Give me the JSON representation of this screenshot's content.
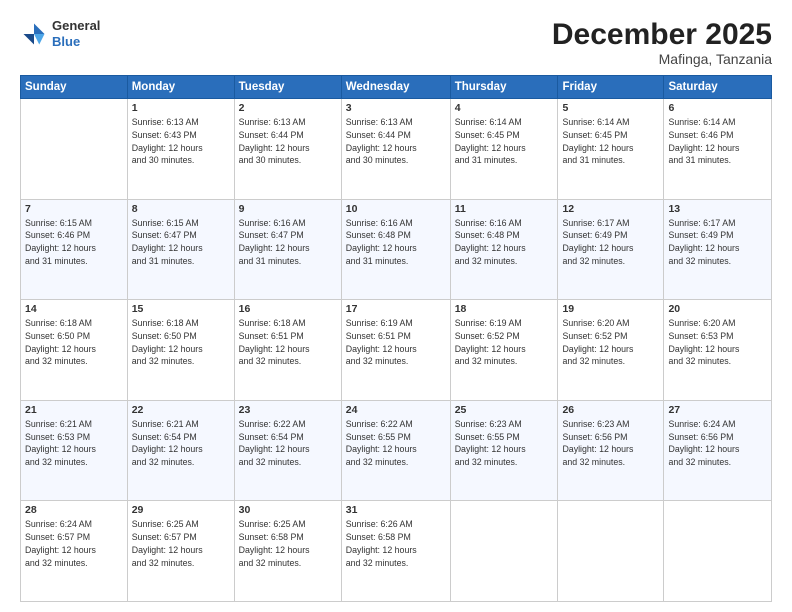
{
  "header": {
    "logo_line1": "General",
    "logo_line2": "Blue",
    "month": "December 2025",
    "location": "Mafinga, Tanzania"
  },
  "weekdays": [
    "Sunday",
    "Monday",
    "Tuesday",
    "Wednesday",
    "Thursday",
    "Friday",
    "Saturday"
  ],
  "weeks": [
    [
      {
        "day": "",
        "info": ""
      },
      {
        "day": "1",
        "info": "Sunrise: 6:13 AM\nSunset: 6:43 PM\nDaylight: 12 hours\nand 30 minutes."
      },
      {
        "day": "2",
        "info": "Sunrise: 6:13 AM\nSunset: 6:44 PM\nDaylight: 12 hours\nand 30 minutes."
      },
      {
        "day": "3",
        "info": "Sunrise: 6:13 AM\nSunset: 6:44 PM\nDaylight: 12 hours\nand 30 minutes."
      },
      {
        "day": "4",
        "info": "Sunrise: 6:14 AM\nSunset: 6:45 PM\nDaylight: 12 hours\nand 31 minutes."
      },
      {
        "day": "5",
        "info": "Sunrise: 6:14 AM\nSunset: 6:45 PM\nDaylight: 12 hours\nand 31 minutes."
      },
      {
        "day": "6",
        "info": "Sunrise: 6:14 AM\nSunset: 6:46 PM\nDaylight: 12 hours\nand 31 minutes."
      }
    ],
    [
      {
        "day": "7",
        "info": "Sunrise: 6:15 AM\nSunset: 6:46 PM\nDaylight: 12 hours\nand 31 minutes."
      },
      {
        "day": "8",
        "info": "Sunrise: 6:15 AM\nSunset: 6:47 PM\nDaylight: 12 hours\nand 31 minutes."
      },
      {
        "day": "9",
        "info": "Sunrise: 6:16 AM\nSunset: 6:47 PM\nDaylight: 12 hours\nand 31 minutes."
      },
      {
        "day": "10",
        "info": "Sunrise: 6:16 AM\nSunset: 6:48 PM\nDaylight: 12 hours\nand 31 minutes."
      },
      {
        "day": "11",
        "info": "Sunrise: 6:16 AM\nSunset: 6:48 PM\nDaylight: 12 hours\nand 32 minutes."
      },
      {
        "day": "12",
        "info": "Sunrise: 6:17 AM\nSunset: 6:49 PM\nDaylight: 12 hours\nand 32 minutes."
      },
      {
        "day": "13",
        "info": "Sunrise: 6:17 AM\nSunset: 6:49 PM\nDaylight: 12 hours\nand 32 minutes."
      }
    ],
    [
      {
        "day": "14",
        "info": "Sunrise: 6:18 AM\nSunset: 6:50 PM\nDaylight: 12 hours\nand 32 minutes."
      },
      {
        "day": "15",
        "info": "Sunrise: 6:18 AM\nSunset: 6:50 PM\nDaylight: 12 hours\nand 32 minutes."
      },
      {
        "day": "16",
        "info": "Sunrise: 6:18 AM\nSunset: 6:51 PM\nDaylight: 12 hours\nand 32 minutes."
      },
      {
        "day": "17",
        "info": "Sunrise: 6:19 AM\nSunset: 6:51 PM\nDaylight: 12 hours\nand 32 minutes."
      },
      {
        "day": "18",
        "info": "Sunrise: 6:19 AM\nSunset: 6:52 PM\nDaylight: 12 hours\nand 32 minutes."
      },
      {
        "day": "19",
        "info": "Sunrise: 6:20 AM\nSunset: 6:52 PM\nDaylight: 12 hours\nand 32 minutes."
      },
      {
        "day": "20",
        "info": "Sunrise: 6:20 AM\nSunset: 6:53 PM\nDaylight: 12 hours\nand 32 minutes."
      }
    ],
    [
      {
        "day": "21",
        "info": "Sunrise: 6:21 AM\nSunset: 6:53 PM\nDaylight: 12 hours\nand 32 minutes."
      },
      {
        "day": "22",
        "info": "Sunrise: 6:21 AM\nSunset: 6:54 PM\nDaylight: 12 hours\nand 32 minutes."
      },
      {
        "day": "23",
        "info": "Sunrise: 6:22 AM\nSunset: 6:54 PM\nDaylight: 12 hours\nand 32 minutes."
      },
      {
        "day": "24",
        "info": "Sunrise: 6:22 AM\nSunset: 6:55 PM\nDaylight: 12 hours\nand 32 minutes."
      },
      {
        "day": "25",
        "info": "Sunrise: 6:23 AM\nSunset: 6:55 PM\nDaylight: 12 hours\nand 32 minutes."
      },
      {
        "day": "26",
        "info": "Sunrise: 6:23 AM\nSunset: 6:56 PM\nDaylight: 12 hours\nand 32 minutes."
      },
      {
        "day": "27",
        "info": "Sunrise: 6:24 AM\nSunset: 6:56 PM\nDaylight: 12 hours\nand 32 minutes."
      }
    ],
    [
      {
        "day": "28",
        "info": "Sunrise: 6:24 AM\nSunset: 6:57 PM\nDaylight: 12 hours\nand 32 minutes."
      },
      {
        "day": "29",
        "info": "Sunrise: 6:25 AM\nSunset: 6:57 PM\nDaylight: 12 hours\nand 32 minutes."
      },
      {
        "day": "30",
        "info": "Sunrise: 6:25 AM\nSunset: 6:58 PM\nDaylight: 12 hours\nand 32 minutes."
      },
      {
        "day": "31",
        "info": "Sunrise: 6:26 AM\nSunset: 6:58 PM\nDaylight: 12 hours\nand 32 minutes."
      },
      {
        "day": "",
        "info": ""
      },
      {
        "day": "",
        "info": ""
      },
      {
        "day": "",
        "info": ""
      }
    ]
  ]
}
